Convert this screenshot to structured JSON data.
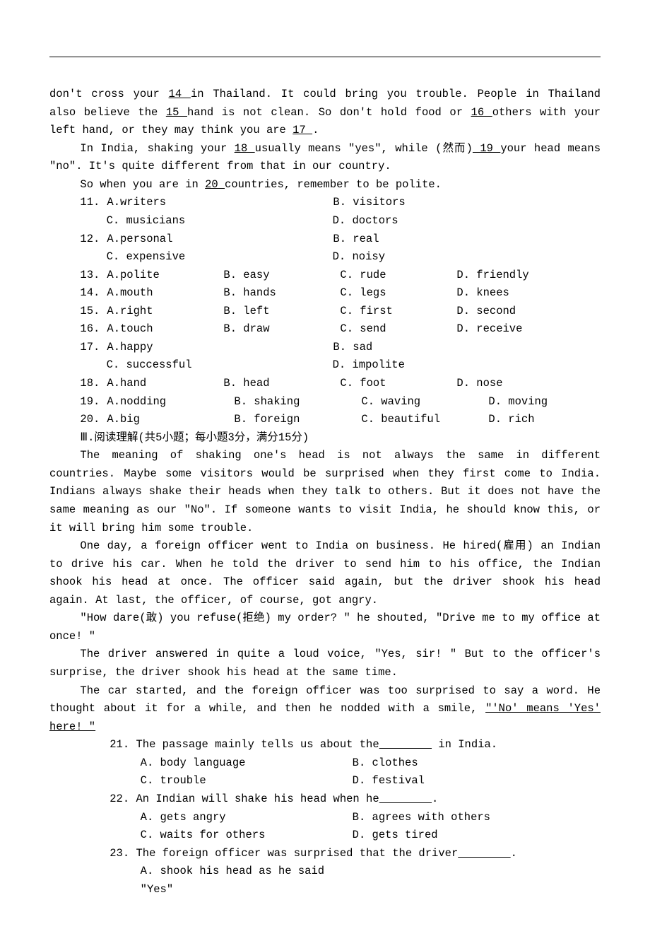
{
  "cloze_intro": {
    "line1_pre": "don't cross your ",
    "blank14": "  14  ",
    "line1_mid": "in Thailand. It could bring you trouble. People in Thailand also believe the ",
    "blank15": " 15 ",
    "line2_mid": " hand is not clean. So don't hold food or ",
    "blank16": "  16  ",
    "line3_mid": " others with your left hand, or they may think you are ",
    "blank17": "  17  ",
    "line3_end": "."
  },
  "cloze_p2": {
    "pre": "In India, shaking your ",
    "blank18": "  18  ",
    "mid1": " usually means \"yes\", while (然而)",
    "blank19": "  19  ",
    "mid2": " your head means \"no\". It's quite different from that in our country."
  },
  "cloze_p3": {
    "pre": "So when you are in ",
    "blank20": "  20  ",
    "post": " countries, remember to be polite."
  },
  "cloze_questions": [
    {
      "num": "11.",
      "a": "A.writers",
      "b": "B. visitors",
      "c": "C. musicians",
      "d": "D. doctors",
      "layout": "two"
    },
    {
      "num": "12.",
      "a": "A.personal",
      "b": "B. real",
      "c": "C. expensive",
      "d": "D. noisy",
      "layout": "two"
    },
    {
      "num": "13.",
      "a": "A.polite",
      "b": "B. easy",
      "c": "C. rude",
      "d": "D. friendly",
      "layout": "four"
    },
    {
      "num": "14.",
      "a": "A.mouth",
      "b": "B. hands",
      "c": "C. legs",
      "d": "D. knees",
      "layout": "four"
    },
    {
      "num": "15.",
      "a": "A.right",
      "b": "B. left",
      "c": "C. first",
      "d": "D. second",
      "layout": "four"
    },
    {
      "num": "16.",
      "a": "A.touch",
      "b": "B. draw",
      "c": "C. send",
      "d": "D. receive",
      "layout": "four"
    },
    {
      "num": "17.",
      "a": "A.happy",
      "b": "B. sad",
      "c": "C. successful",
      "d": "D. impolite",
      "layout": "two"
    },
    {
      "num": "18.",
      "a": "A.hand",
      "b": "B. head",
      "c": "C. foot",
      "d": "D. nose",
      "layout": "four"
    },
    {
      "num": "19.",
      "a": "A.nodding",
      "b": "B. shaking",
      "c": "C. waving",
      "d": "D. moving",
      "layout": "four_wide"
    },
    {
      "num": "20.",
      "a": "A.big",
      "b": "B. foreign",
      "c": "C. beautiful",
      "d": "D. rich",
      "layout": "four_wide"
    }
  ],
  "section3_title": "Ⅲ.阅读理解(共5小题；每小题3分，满分15分)",
  "reading": {
    "p1": "The meaning of shaking one's head is not always the same in different countries. Maybe some visitors would be surprised when they first come to India. Indians always shake their heads when they talk to others. But it does not have the same meaning as our \"No\". If someone wants to visit India, he should know this, or it will bring him some trouble.",
    "p2": "One day, a foreign officer went to India on business. He hired(雇用) an Indian to drive his car. When he told the driver to send him to his office, the Indian shook his head at once. The officer said again, but the driver shook his head again. At last, the officer, of course, got angry.",
    "p3": "\"How dare(敢) you refuse(拒绝) my order? \" he shouted, \"Drive me to my office at once! \"",
    "p4": "The driver answered in quite a loud voice, \"Yes, sir! \" But to the officer's surprise, the driver shook his head at the same time.",
    "p5_a": "The car started, and the foreign officer was too surprised to say a word. He thought about it for a while, and then he nodded with a smile, ",
    "p5_u": "\"'No'  means  'Yes'  here! \""
  },
  "reading_questions": [
    {
      "num": "21.",
      "stem_pre": "The passage mainly tells us about the",
      "blank": "        ",
      "stem_post": " in India.",
      "opts": [
        {
          "a": "A. body language",
          "b": "B. clothes"
        },
        {
          "a": "C. trouble",
          "b": "D. festival"
        }
      ]
    },
    {
      "num": "22.",
      "stem_pre": "An Indian will shake his head when he",
      "blank": "        ",
      "stem_post": ".",
      "opts": [
        {
          "a": "A. gets angry",
          "b": "B. agrees with others"
        },
        {
          "a": "C. waits for others",
          "b": "D. gets tired"
        }
      ]
    },
    {
      "num": "23.",
      "stem_pre": "The foreign officer was surprised that the driver",
      "blank": "        ",
      "stem_post": ".",
      "opts": [
        {
          "a": "A. shook his head as he said \"Yes\"",
          "b": ""
        }
      ]
    }
  ]
}
